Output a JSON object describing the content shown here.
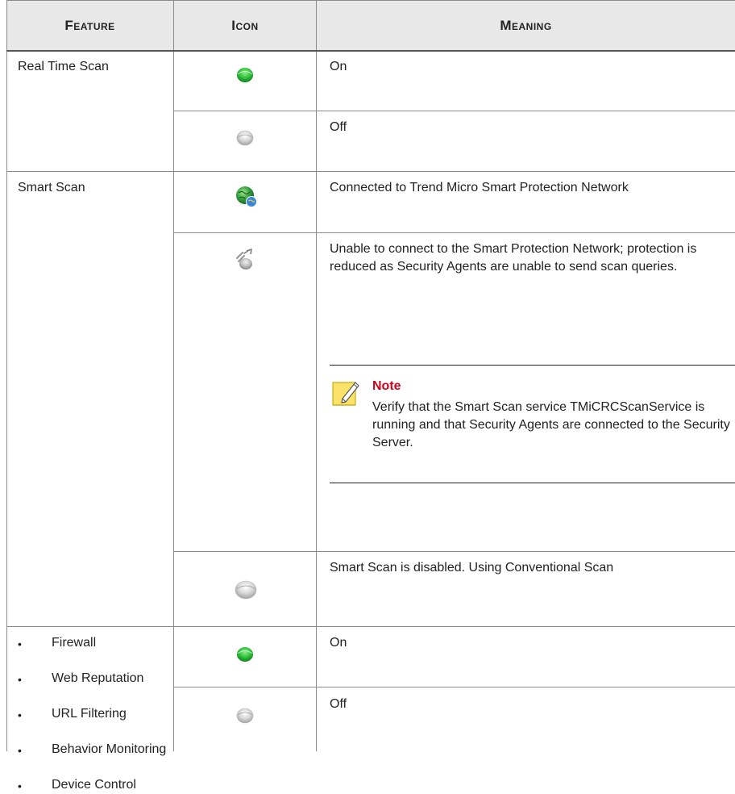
{
  "table": {
    "headers": {
      "feature": "Feature",
      "icon": "Icon",
      "meaning": "Meaning"
    },
    "rows": {
      "real_time_scan": {
        "feature": "Real Time Scan",
        "on_meaning": "On",
        "off_meaning": "Off"
      },
      "smart_scan": {
        "feature": "Smart Scan",
        "connected_meaning": "Connected to Trend Micro Smart Protection Network",
        "unable_meaning": "Unable to connect to the Smart Protection Network; protection is reduced as Security Agents are unable to send scan queries.",
        "note_title": "Note",
        "note_text": "Verify that the Smart Scan service TMiCRCScanService is running and that Security Agents are connected to the Security Server.",
        "disabled_meaning": "Smart Scan is disabled. Using Conventional Scan"
      },
      "other_features": {
        "items": [
          "Firewall",
          "Web Reputation",
          "URL Filtering",
          "Behavior Monitoring",
          "Device Control"
        ],
        "on_meaning": "On",
        "off_meaning": "Off"
      }
    },
    "icons": {
      "status_on": "green-dot-icon",
      "status_off": "gray-dot-icon",
      "smart_connected": "globe-connected-icon",
      "smart_disconnected": "disconnected-icon",
      "note": "note-pencil-icon"
    },
    "colors": {
      "header_bg": "#e8e8e8",
      "note_title": "#d0021b",
      "on_green": "#2fbf3a",
      "off_gray": "#d6d6d6"
    }
  }
}
